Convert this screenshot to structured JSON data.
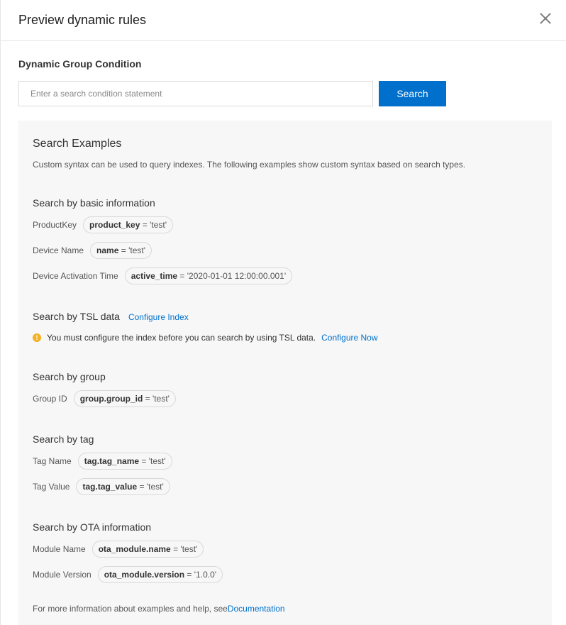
{
  "dialog": {
    "title": "Preview dynamic rules"
  },
  "condition": {
    "section_title": "Dynamic Group Condition",
    "placeholder": "Enter a search condition statement",
    "search_label": "Search"
  },
  "examples": {
    "title": "Search Examples",
    "description": "Custom syntax can be used to query indexes. The following examples show custom syntax based on search types.",
    "basic": {
      "title": "Search by basic information",
      "rows": [
        {
          "label": "ProductKey",
          "key": "product_key",
          "value": " = 'test'"
        },
        {
          "label": "Device Name",
          "key": "name",
          "value": " = 'test'"
        },
        {
          "label": "Device Activation Time",
          "key": "active_time",
          "value": " = '2020-01-01 12:00:00.001'"
        }
      ]
    },
    "tsl": {
      "title": "Search by TSL data",
      "link": "Configure Index",
      "notice_icon": "!",
      "notice": "You must configure the index before you can search by using TSL data.",
      "notice_link": "Configure Now"
    },
    "group": {
      "title": "Search by group",
      "rows": [
        {
          "label": "Group ID",
          "key": "group.group_id",
          "value": " = 'test'"
        }
      ]
    },
    "tag": {
      "title": "Search by tag",
      "rows": [
        {
          "label": "Tag Name",
          "key": "tag.tag_name",
          "value": " = 'test'"
        },
        {
          "label": "Tag Value",
          "key": "tag.tag_value",
          "value": " = 'test'"
        }
      ]
    },
    "ota": {
      "title": "Search by OTA information",
      "rows": [
        {
          "label": "Module Name",
          "key": "ota_module.name",
          "value": " = 'test'"
        },
        {
          "label": "Module Version",
          "key": "ota_module.version",
          "value": " = '1.0.0'"
        }
      ]
    },
    "footer": {
      "text": "For more information about examples and help, see",
      "link": "Documentation"
    }
  },
  "colors": {
    "accent": "#0070cc",
    "warning": "#f5b123",
    "panel_bg": "#f7f7f7"
  }
}
